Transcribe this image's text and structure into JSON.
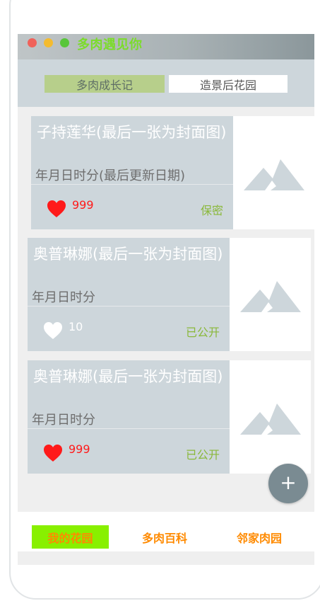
{
  "app": {
    "title": "多肉遇见你",
    "colors": {
      "accent": "#7bdc2a",
      "like_red": "#ff1a1a",
      "status_green": "#8ab83a",
      "nav_orange": "#ff8a00",
      "nav_active_bg": "#88f000"
    }
  },
  "tabs": [
    {
      "label": "多肉成长记",
      "active": true
    },
    {
      "label": "造景后花园",
      "active": false
    }
  ],
  "cards": [
    {
      "title": "子持莲华(最后一张为封面图)",
      "date": "年月日时分(最后更新日期)",
      "likes": "999",
      "liked": true,
      "status": "保密",
      "thumb_icon": "mountain-placeholder-icon"
    },
    {
      "title": "奥普琳娜(最后一张为封面图)",
      "date": "年月日时分",
      "likes": "10",
      "liked": false,
      "status": "已公开",
      "thumb_icon": "mountain-placeholder-icon"
    },
    {
      "title": "奥普琳娜(最后一张为封面图)",
      "date": "年月日时分",
      "likes": "999",
      "liked": true,
      "status": "已公开",
      "thumb_icon": "mountain-placeholder-icon"
    }
  ],
  "fab": {
    "label": "+"
  },
  "bottom_nav": [
    {
      "label": "我的花园",
      "active": true
    },
    {
      "label": "多肉百科",
      "active": false
    },
    {
      "label": "邻家肉园",
      "active": false
    }
  ]
}
